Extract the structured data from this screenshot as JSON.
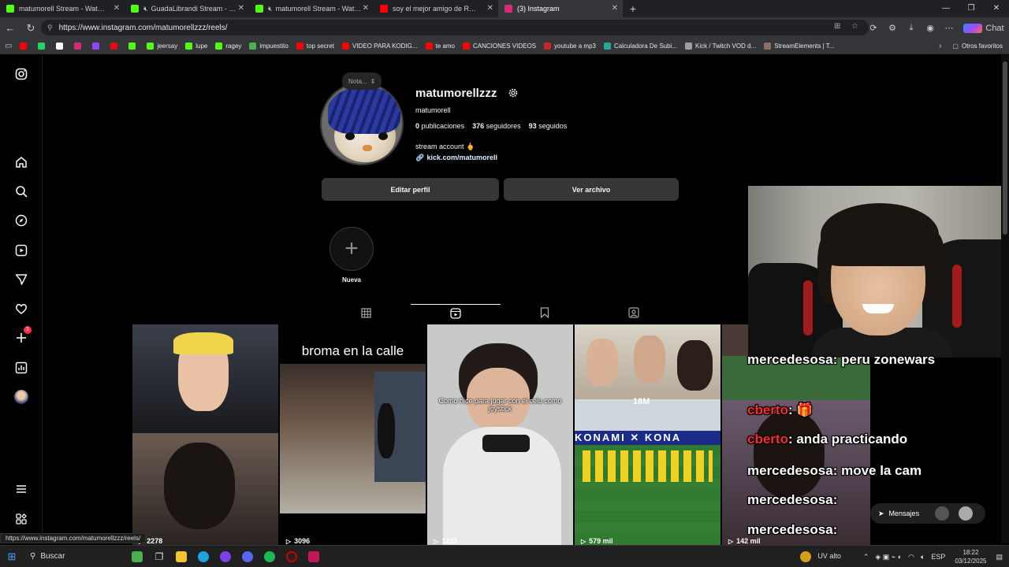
{
  "browser": {
    "tabs": [
      {
        "title": "matumorell Stream - Watch Live o",
        "color": "#53fc18",
        "muted": false,
        "active": false
      },
      {
        "title": "GuadaLibrandi Stream - Watch Li",
        "color": "#53fc18",
        "muted": true,
        "active": false
      },
      {
        "title": "matumorell Stream - Watch Live o",
        "color": "#53fc18",
        "muted": true,
        "active": false
      },
      {
        "title": "soy el mejor amigo de RAGEYLO",
        "color": "#ff0000",
        "muted": false,
        "active": false
      },
      {
        "title": "(3) Instagram",
        "color": "#d62976",
        "muted": false,
        "active": true
      }
    ],
    "url": "https://www.instagram.com/matumorellzzz/reels/",
    "chat_label": "Chat",
    "bookmarks": [
      {
        "label": "",
        "color": "#ff0000"
      },
      {
        "label": "",
        "color": "#25d366"
      },
      {
        "label": "",
        "color": "#ffffff"
      },
      {
        "label": "",
        "color": "#d62976"
      },
      {
        "label": "",
        "color": "#9146ff"
      },
      {
        "label": "",
        "color": "#e50914"
      },
      {
        "label": "",
        "color": "#53fc18"
      },
      {
        "label": "jeersay",
        "color": "#53fc18"
      },
      {
        "label": "lupe",
        "color": "#53fc18"
      },
      {
        "label": "ragey",
        "color": "#53fc18"
      },
      {
        "label": "impuestito",
        "color": "#4caf50"
      },
      {
        "label": "top secret",
        "color": "#ff0000"
      },
      {
        "label": "VIDEO PARA KODIG...",
        "color": "#ff0000"
      },
      {
        "label": "te amo",
        "color": "#ff0000"
      },
      {
        "label": "CANCIONES VIDEOS",
        "color": "#ff0000"
      },
      {
        "label": "youtube a mp3",
        "color": "#c62828"
      },
      {
        "label": "Calculadora De Subi...",
        "color": "#26a69a"
      },
      {
        "label": "Kick / Twitch VOD d...",
        "color": "#9e9e9e"
      },
      {
        "label": "StreamElements | T...",
        "color": "#8d6e63"
      }
    ],
    "other_favorites": "Otros favoritos",
    "status_url": "https://www.instagram.com/matumorellzzz/reels/"
  },
  "profile": {
    "note": "Nota...",
    "username": "matumorellzzz",
    "full_name": "matumorell",
    "posts_count": "0",
    "posts_label": "publicaciones",
    "followers_count": "376",
    "followers_label": "seguidores",
    "following_count": "93",
    "following_label": "seguidos",
    "bio": "stream account 🖕",
    "link": "kick.com/matumorell",
    "edit_button": "Editar perfil",
    "archive_button": "Ver archivo",
    "highlight_new": "Nueva"
  },
  "reels": [
    {
      "views": "2278",
      "caption": ""
    },
    {
      "views": "3096",
      "caption": "broma en la calle"
    },
    {
      "views": "1223",
      "caption": "Como hice para jugar con el celu como joystick"
    },
    {
      "views": "579 mil",
      "caption": "18M"
    },
    {
      "views": "142 mil",
      "caption": ""
    }
  ],
  "chat_overlay": [
    {
      "user": "mercedesosa",
      "text": ": peru zonewars",
      "user_color": "#ffffff"
    },
    {
      "user": "cberto",
      "text": ": 🎁",
      "user_color": "#ff2a2a"
    },
    {
      "user": "cberto",
      "text": ": anda practicando",
      "user_color": "#ff2a2a"
    },
    {
      "user": "mercedesosa",
      "text": ": move la cam",
      "user_color": "#ffffff"
    },
    {
      "user": "mercedesosa",
      "text": ":",
      "user_color": "#ffffff"
    },
    {
      "user": "mercedesosa",
      "text": ":",
      "user_color": "#ffffff"
    }
  ],
  "messages_label": "Mensajes",
  "notification_count": "1",
  "taskbar": {
    "search_label": "Buscar",
    "weather": "UV alto",
    "lang": "ESP",
    "time": "18:22",
    "date": "03/12/2025"
  }
}
